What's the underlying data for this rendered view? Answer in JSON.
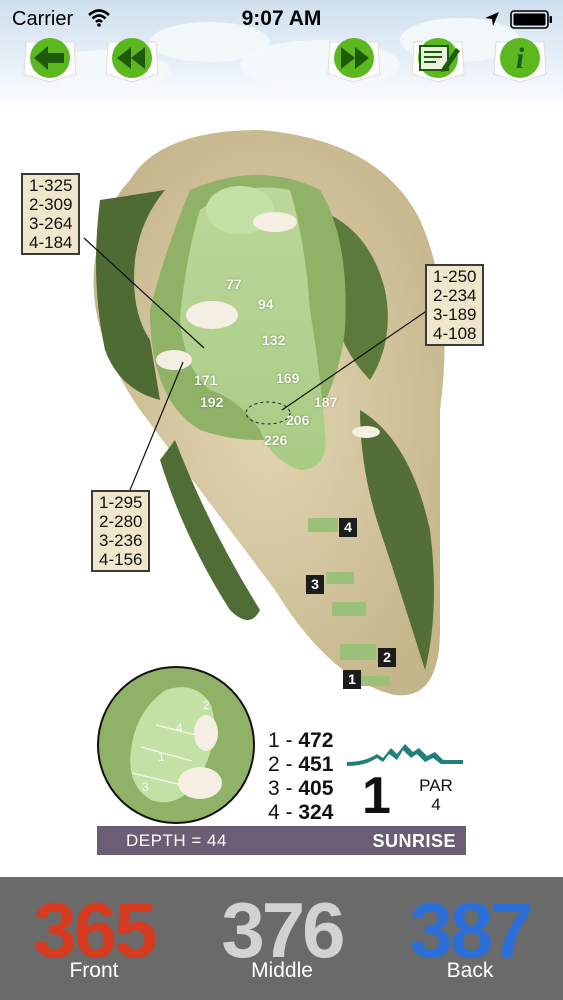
{
  "status_bar": {
    "carrier": "Carrier",
    "time": "9:07 AM"
  },
  "toolbar": {
    "back": "back-arrow-icon",
    "previous_hole": "rewind-icon",
    "next_hole": "fast-forward-icon",
    "scorecard": "scorecard-pencil-icon",
    "info": "info-icon",
    "info_glyph": "i"
  },
  "map": {
    "callouts": {
      "upper_left": [
        "1-325",
        "2-309",
        "3-264",
        "4-184"
      ],
      "right": [
        "1-250",
        "2-234",
        "3-189",
        "4-108"
      ],
      "lower_left": [
        "1-295",
        "2-280",
        "3-236",
        "4-156"
      ]
    },
    "yardage_dots": [
      "77",
      "94",
      "132",
      "171",
      "169",
      "192",
      "187",
      "206",
      "226"
    ],
    "tee_markers": [
      "4",
      "3",
      "2",
      "1"
    ]
  },
  "hole_info": {
    "green_zones": [
      "2",
      "4",
      "1",
      "3"
    ],
    "tees": [
      {
        "prefix": "1 -",
        "yards": "472"
      },
      {
        "prefix": "2 -",
        "yards": "451"
      },
      {
        "prefix": "3 -",
        "yards": "405"
      },
      {
        "prefix": "4 -",
        "yards": "324"
      }
    ],
    "hole_number": "1",
    "par_label": "PAR",
    "par_value": "4",
    "depth": "DEPTH = 44",
    "course_name": "SUNRISE"
  },
  "distances": {
    "front": {
      "value": "365",
      "label": "Front",
      "color": "#d63a1f"
    },
    "middle": {
      "value": "376",
      "label": "Middle",
      "color": "#d2d2d2"
    },
    "back": {
      "value": "387",
      "label": "Back",
      "color": "#2d6fd8"
    }
  },
  "colors": {
    "toolbar_green": "#5bb81f",
    "depth_bar": "#6b5d73",
    "bottom_bar": "#6a6a6a",
    "logo_teal": "#1f7f7a"
  }
}
